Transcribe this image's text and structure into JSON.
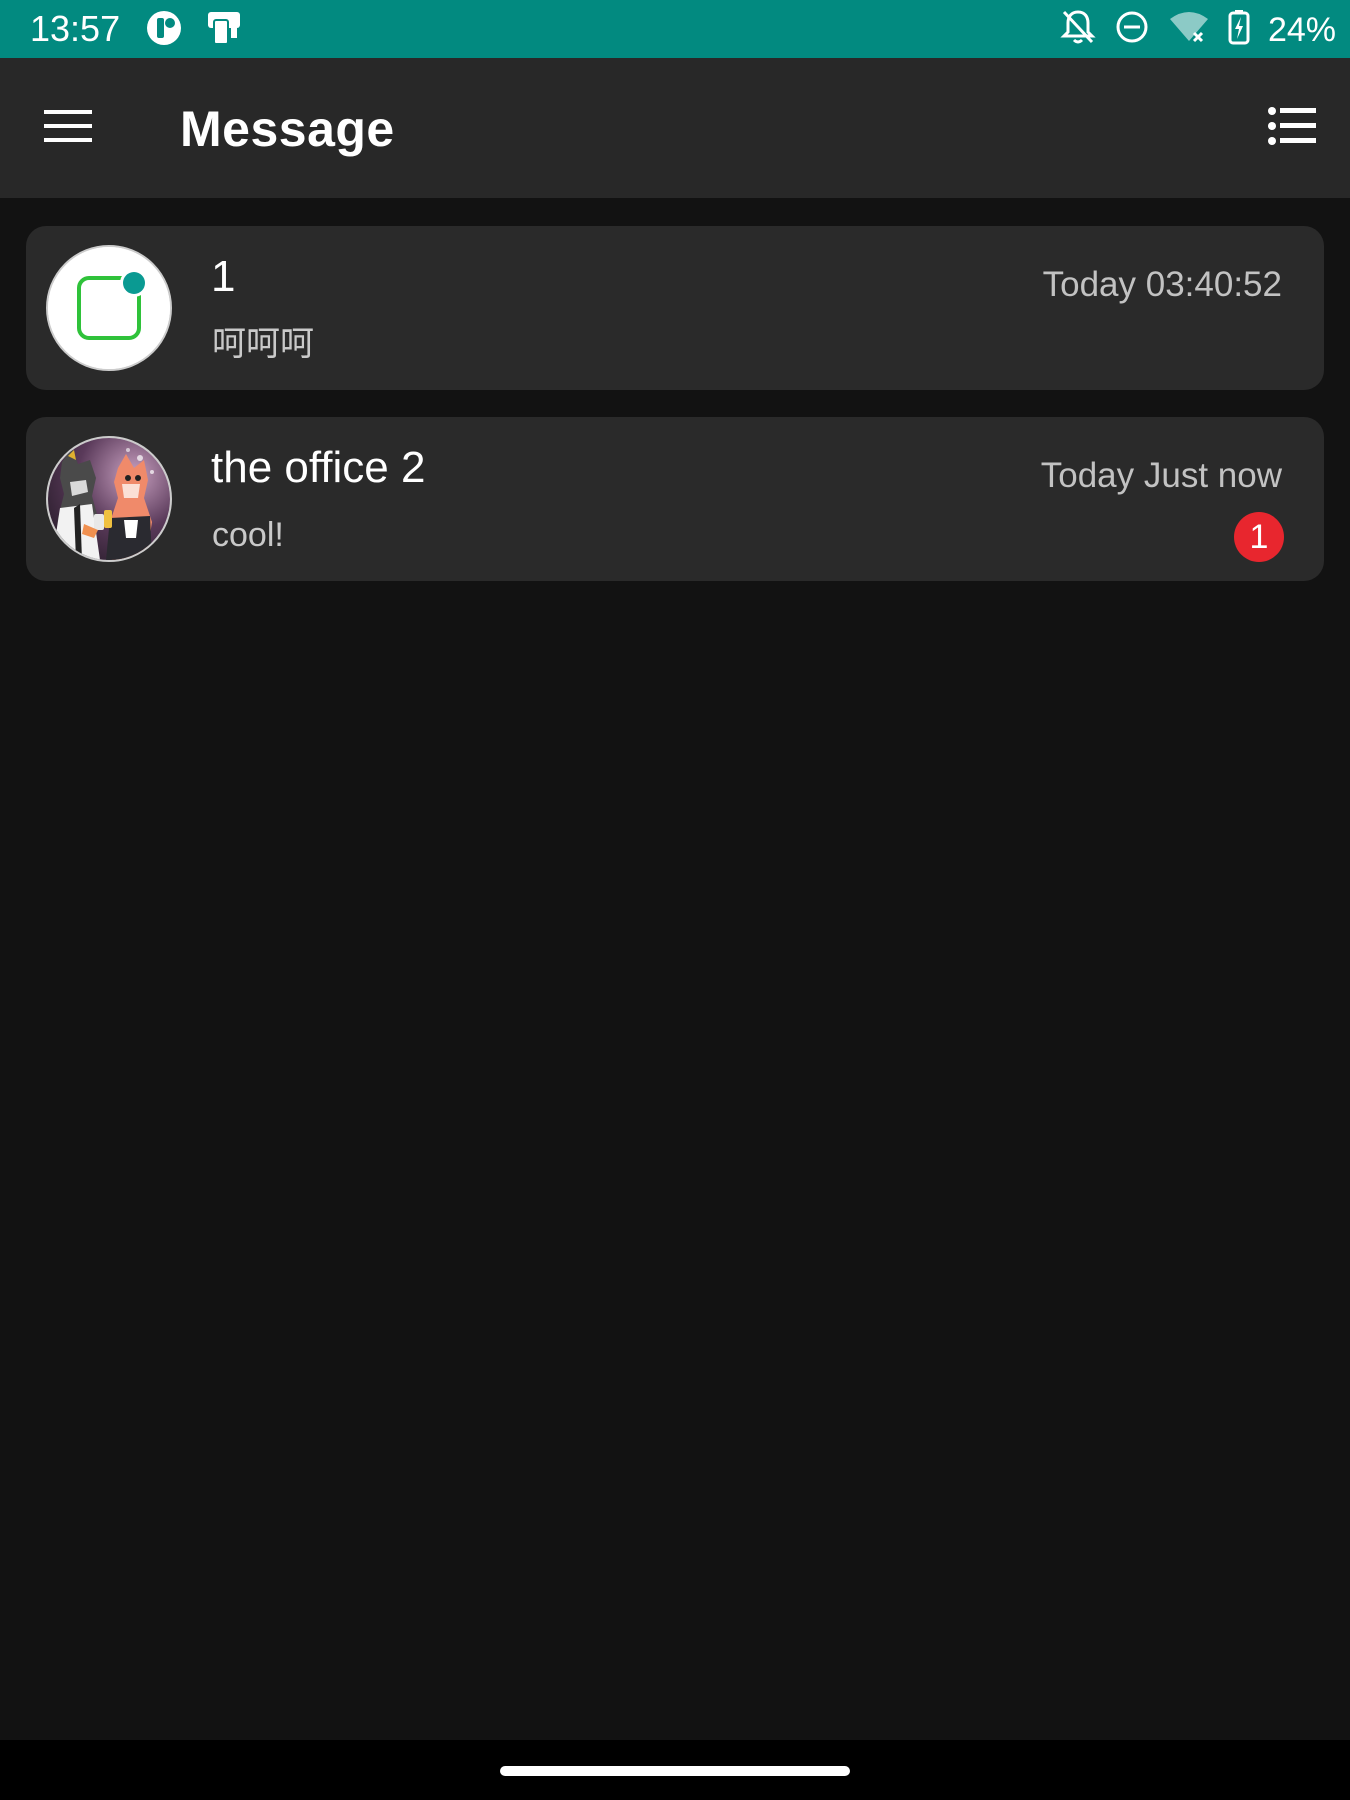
{
  "status_bar": {
    "time": "13:57",
    "left_icons": [
      "notification-app-icon",
      "phone-device-icon"
    ],
    "right_icons": [
      "bell-off-icon",
      "do-not-disturb-icon",
      "wifi-off-icon",
      "battery-charging-icon"
    ],
    "battery_percent": "24%",
    "background_color": "#028a80"
  },
  "app_bar": {
    "menu_icon": "hamburger-menu-icon",
    "title": "Message",
    "list_icon": "list-icon",
    "background_color": "#282828"
  },
  "conversations": [
    {
      "name": "1",
      "preview": "呵呵呵",
      "time": "Today 03:40:52",
      "avatar": "app-logo-avatar",
      "unread": ""
    },
    {
      "name": "the office 2",
      "preview": "cool!",
      "time": "Today Just now",
      "avatar": "illustrated-group-avatar",
      "unread": "1"
    }
  ],
  "colors": {
    "background": "#121212",
    "card": "#2a2a2a",
    "unread_badge": "#e8262e",
    "avatar_green": "#2fc23a",
    "avatar_teal": "#0a9a92"
  }
}
